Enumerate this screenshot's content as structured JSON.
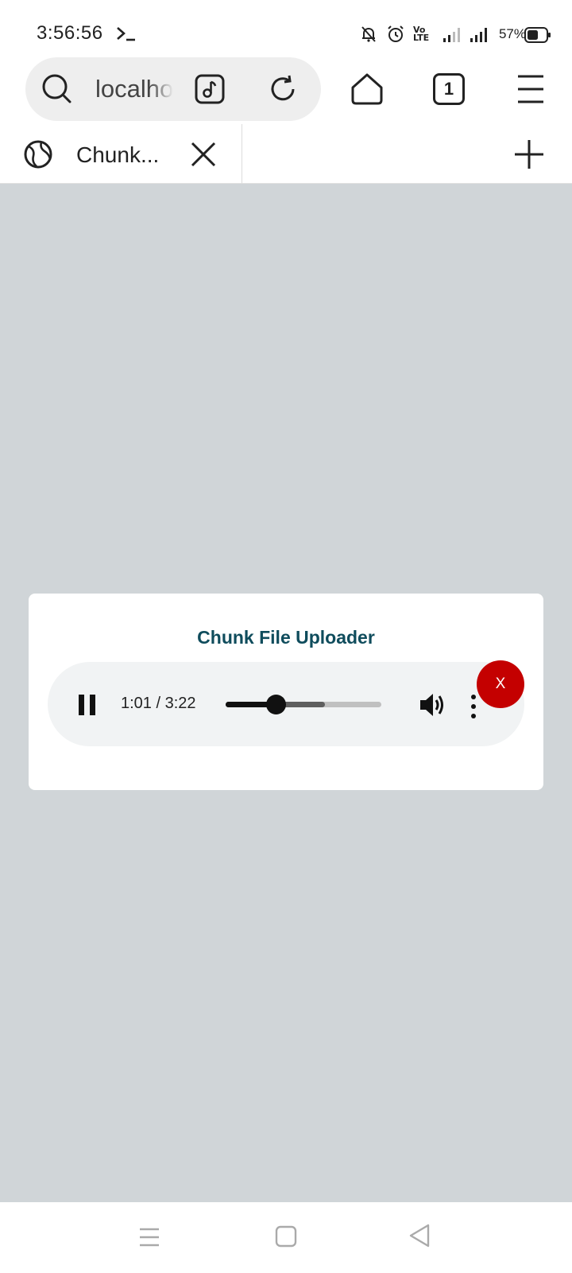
{
  "status_bar": {
    "time": "3:56:56",
    "volte": "Vo LTE",
    "battery_percent": "57%",
    "icons": [
      "terminal-icon",
      "mute-bell-icon",
      "alarm-icon",
      "volte-icon",
      "signal-weak-icon",
      "signal-icon",
      "battery-icon"
    ]
  },
  "toolbar": {
    "url_text": "localhost",
    "tabs_count": "1",
    "icons": [
      "search-icon",
      "music-icon",
      "reload-icon",
      "home-icon",
      "menu-icon"
    ]
  },
  "tab_strip": {
    "tab_title": "Chunk...",
    "icons": [
      "globe-icon",
      "close-icon",
      "plus-icon"
    ]
  },
  "card": {
    "title": "Chunk File Uploader",
    "close_button_label": "X",
    "accent_color": "#c40000",
    "title_color": "#0f4c5c"
  },
  "audio_player": {
    "state": "playing",
    "current_time": "1:01",
    "duration": "3:22",
    "time_display": "1:01  / 3:22",
    "played_fraction": 0.32,
    "buffered_fraction": 0.64
  },
  "nav_bar": {
    "icons": [
      "recents-icon",
      "home-icon",
      "back-icon"
    ]
  }
}
